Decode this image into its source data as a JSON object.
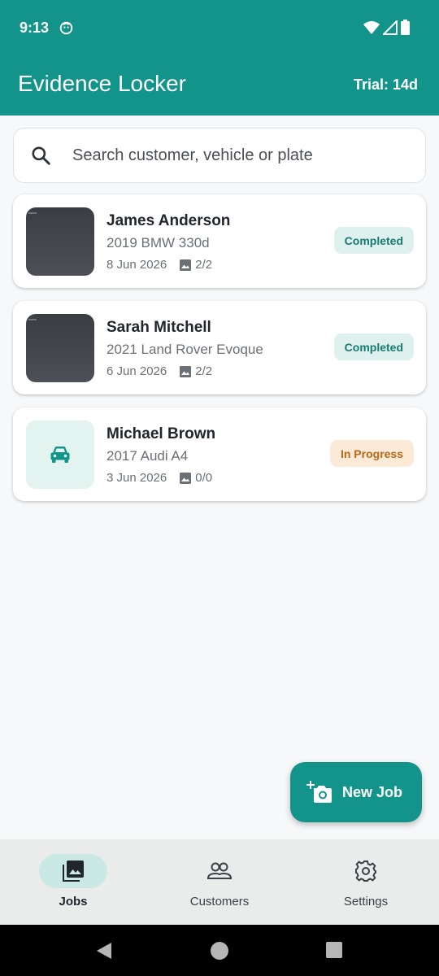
{
  "status_bar": {
    "time": "9:13",
    "icons": [
      "app-notification-icon",
      "wifi-icon",
      "signal-icon",
      "battery-icon"
    ]
  },
  "app_bar": {
    "title": "Evidence Locker",
    "trial": "Trial: 14d"
  },
  "search": {
    "placeholder": "Search customer, vehicle or plate",
    "icon": "search-icon"
  },
  "jobs": [
    {
      "name": "James Anderson",
      "vehicle": "2019 BMW 330d",
      "date": "8 Jun 2026",
      "photos": "2/2",
      "status": "Completed",
      "thumb": "photo"
    },
    {
      "name": "Sarah Mitchell",
      "vehicle": "2021 Land Rover Evoque",
      "date": "6 Jun 2026",
      "photos": "2/2",
      "status": "Completed",
      "thumb": "photo"
    },
    {
      "name": "Michael Brown",
      "vehicle": "2017 Audi A4",
      "date": "3 Jun 2026",
      "photos": "0/0",
      "status": "In Progress",
      "thumb": "car-icon"
    }
  ],
  "fab": {
    "label": "New Job",
    "icon": "add-photo-icon"
  },
  "bottom_nav": [
    {
      "label": "Jobs",
      "icon": "photo-library-icon",
      "active": true
    },
    {
      "label": "Customers",
      "icon": "people-icon",
      "active": false
    },
    {
      "label": "Settings",
      "icon": "gear-icon",
      "active": false
    }
  ],
  "colors": {
    "primary": "#13948a",
    "completed_bg": "#dff1ee",
    "completed_text": "#167a70",
    "progress_bg": "#fbead8",
    "progress_text": "#b86818"
  }
}
